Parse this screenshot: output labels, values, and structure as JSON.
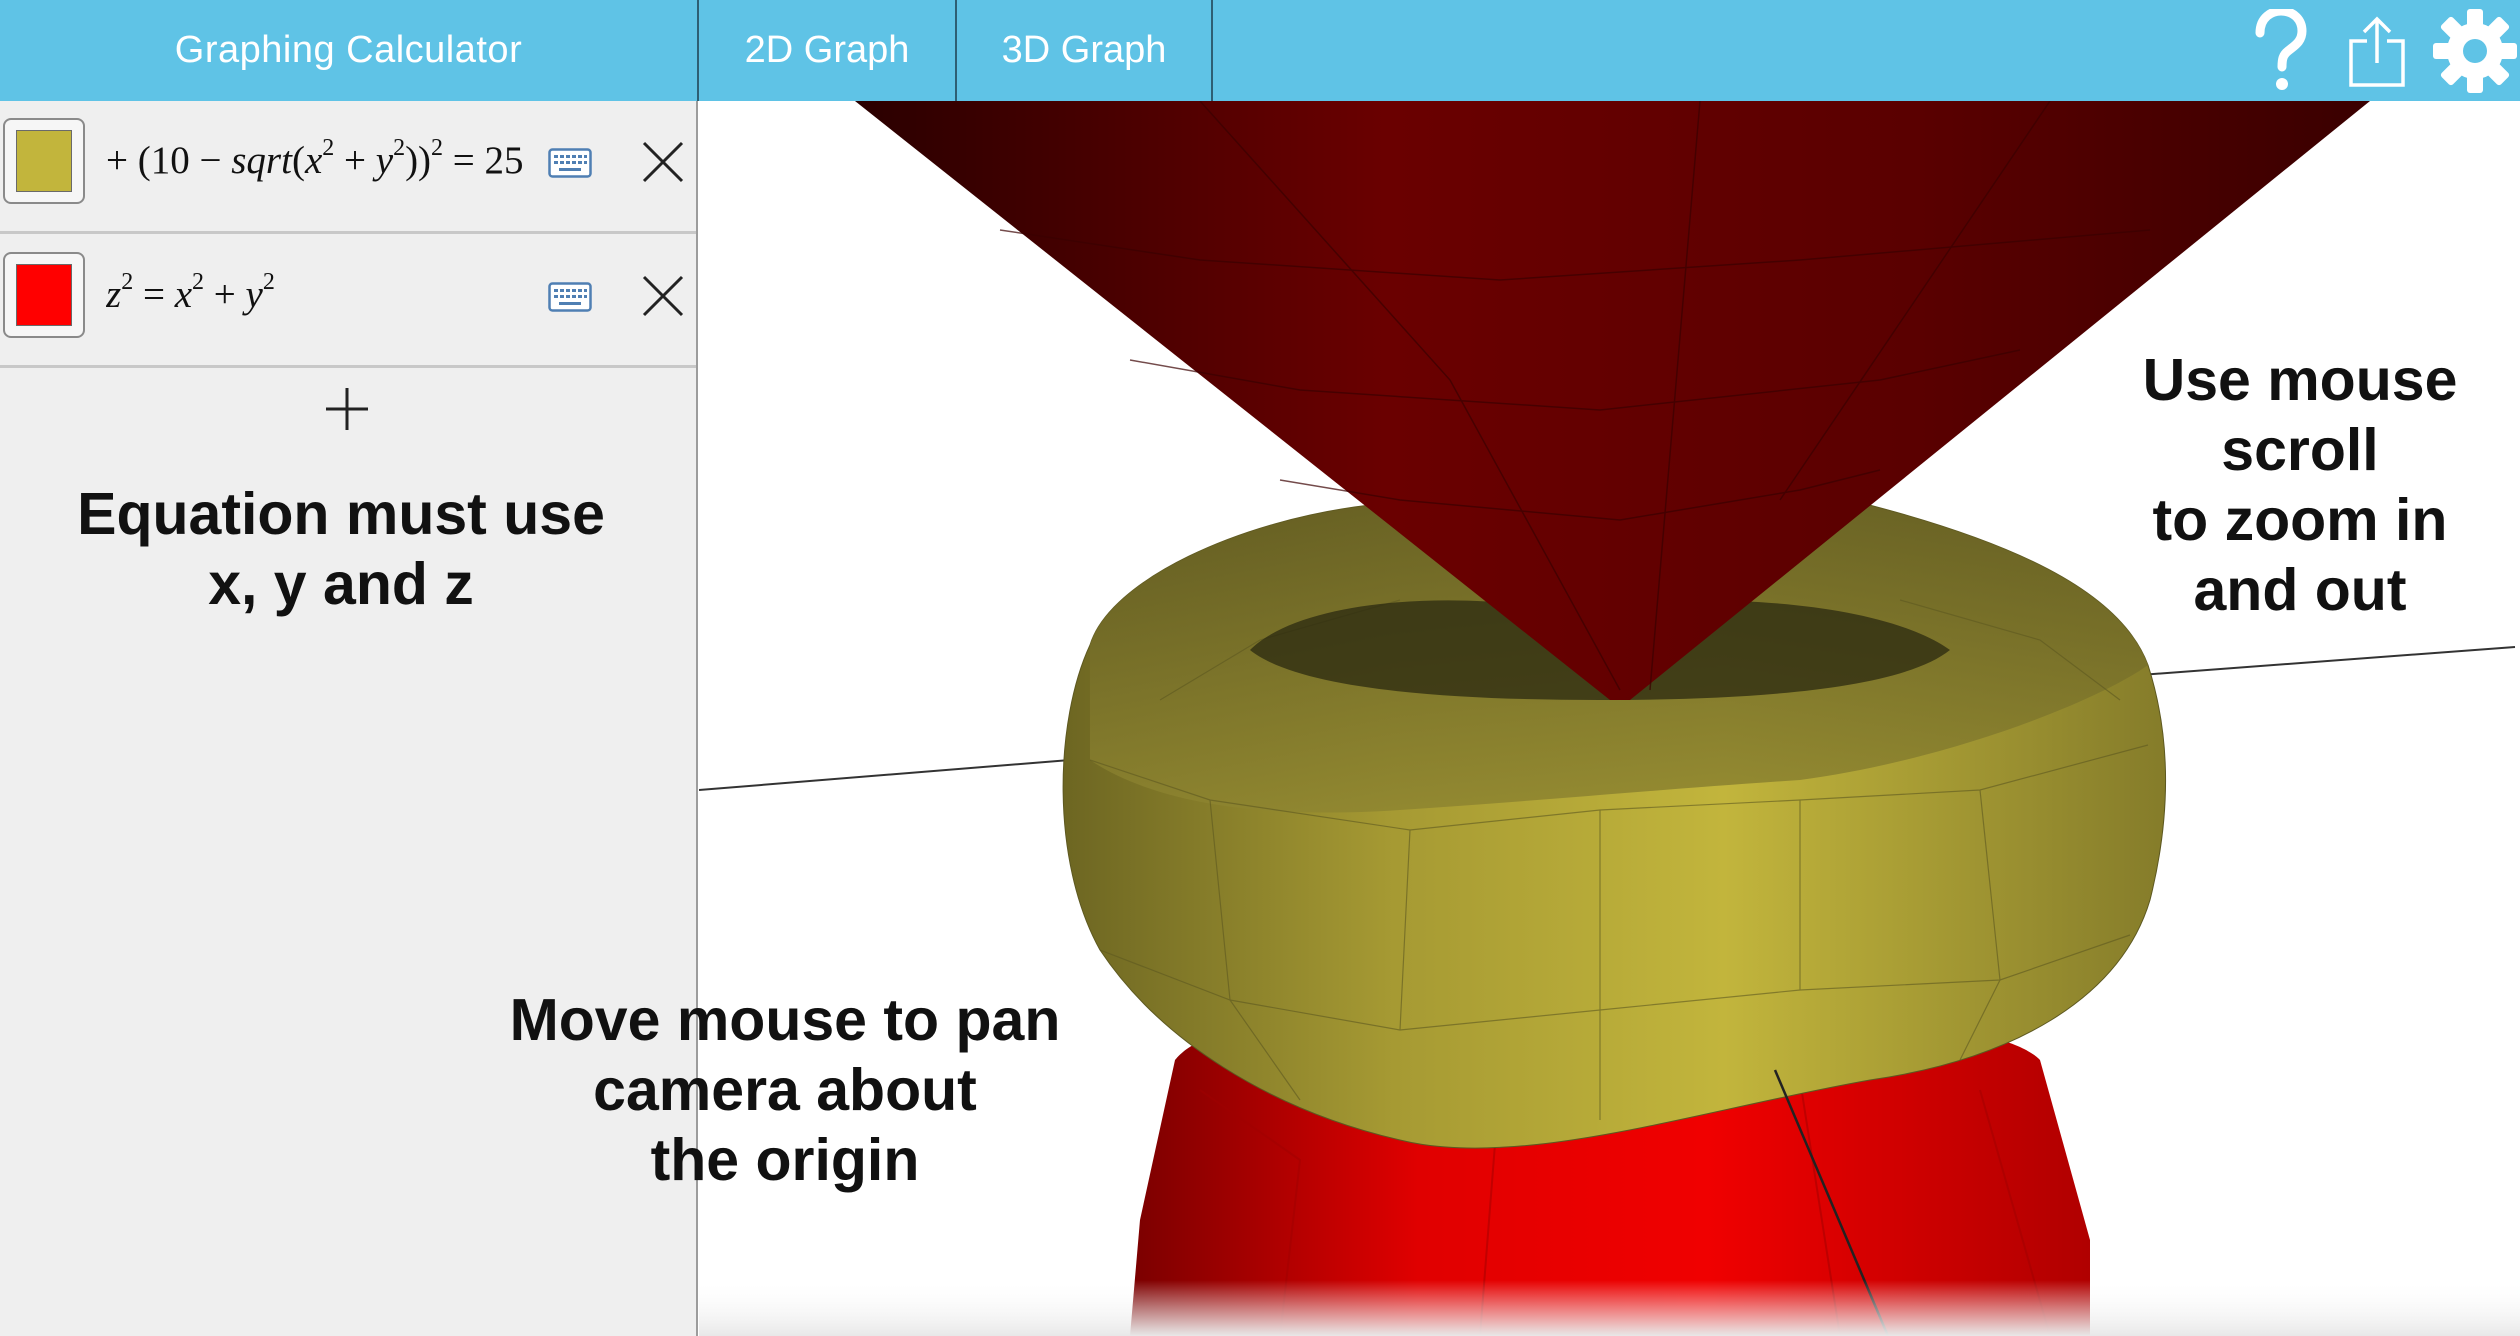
{
  "header": {
    "app_title": "Graphing Calculator",
    "tabs": [
      {
        "label": "2D Graph",
        "selected": false
      },
      {
        "label": "3D Graph",
        "selected": true
      }
    ],
    "icons": [
      "help-icon",
      "share-icon",
      "gear-icon"
    ],
    "bar_color": "#5fc3e6"
  },
  "equations": [
    {
      "color": "#c2b53c",
      "plain": "+ (10 − sqrt(x^2 + y^2))^2 = 2",
      "parts": {
        "lead": "+ (10 − ",
        "fn": "sqrt",
        "x": "x",
        "y": "y",
        "exp": "2",
        "tail": " = 25"
      }
    },
    {
      "color": "#ff0000",
      "plain": "z^2 = x^2 + y^2",
      "parts": {
        "z": "z",
        "x": "x",
        "y": "y",
        "exp": "2"
      }
    }
  ],
  "sidebar": {
    "add_button": "+",
    "hint": "Equation must use\nx, y and z",
    "hint_line1": "Equation must use",
    "hint_line2": "x, y and z"
  },
  "canvas": {
    "hint_zoom": "Use mouse\nscroll\nto zoom in\nand out",
    "hint_pan": "Move mouse to pan\ncamera about\nthe origin",
    "surface_colors": {
      "cone": "#c00000",
      "cone_dark": "#5e0000",
      "torus": "#c2b53c",
      "torus_dark": "#6d6622"
    }
  }
}
